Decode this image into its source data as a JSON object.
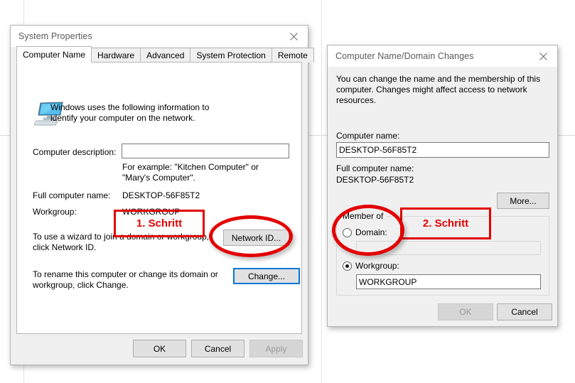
{
  "colors": {
    "annotation_red": "#e30000",
    "focus_blue": "#0078d7",
    "dialog_face": "#f0f0f0",
    "titlebar": "#ffffff"
  },
  "system_properties": {
    "title": "System Properties",
    "close_icon": "close-icon",
    "tabs": [
      {
        "label": "Computer Name",
        "active": true
      },
      {
        "label": "Hardware",
        "active": false
      },
      {
        "label": "Advanced",
        "active": false
      },
      {
        "label": "System Protection",
        "active": false
      },
      {
        "label": "Remote",
        "active": false
      }
    ],
    "intro_text": "Windows uses the following information to identify your computer on the network.",
    "computer_icon": "computer-monitor-icon",
    "computer_description_label": "Computer description:",
    "computer_description_value": "",
    "computer_description_example": "For example: \"Kitchen Computer\" or \"Mary's Computer\".",
    "full_computer_name_label": "Full computer name:",
    "full_computer_name_value": "DESKTOP-56F85T2",
    "workgroup_label": "Workgroup:",
    "workgroup_value": "WORKGROUP",
    "network_id_help": "To use a wizard to join a domain or workgroup, click Network ID.",
    "network_id_button": "Network ID...",
    "change_help": "To rename this computer or change its domain or workgroup, click Change.",
    "change_button": "Change...",
    "ok_button": "OK",
    "cancel_button": "Cancel",
    "apply_button": "Apply",
    "apply_disabled": true
  },
  "domain_changes": {
    "title": "Computer Name/Domain Changes",
    "close_icon": "close-icon",
    "body_text": "You can change the name and the membership of this computer. Changes might affect access to network resources.",
    "computer_name_label": "Computer name:",
    "computer_name_value": "DESKTOP-56F85T2",
    "full_computer_name_label": "Full computer name:",
    "full_computer_name_value": "DESKTOP-56F85T2",
    "more_button": "More...",
    "member_of_legend": "Member of",
    "domain_radio_label": "Domain:",
    "domain_radio_checked": false,
    "domain_value": "",
    "domain_input_disabled": true,
    "workgroup_radio_label": "Workgroup:",
    "workgroup_radio_checked": true,
    "workgroup_value": "WORKGROUP",
    "ok_button": "OK",
    "ok_disabled": true,
    "cancel_button": "Cancel"
  },
  "annotations": {
    "step1_label": "1. Schritt",
    "step2_label": "2. Schritt"
  }
}
